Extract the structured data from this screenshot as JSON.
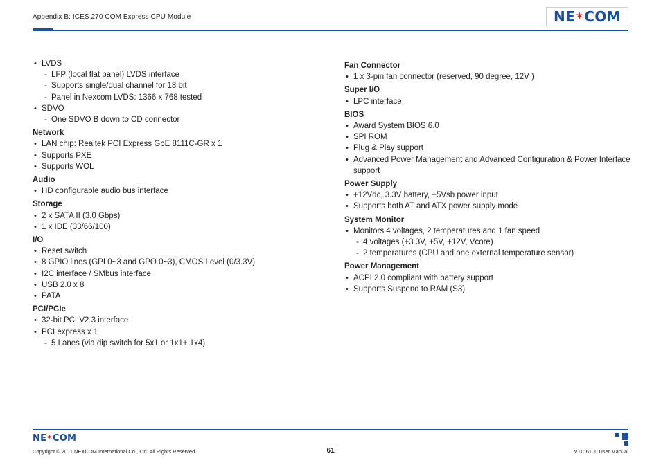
{
  "header": {
    "title": "Appendix B: ICES 270 COM Express CPU Module",
    "logo": {
      "pre": "NE",
      "star": "✶",
      "post": "COM"
    }
  },
  "left_column": [
    {
      "type": "bullets",
      "items": [
        {
          "text": "LVDS",
          "sub": [
            "LFP (local flat panel) LVDS interface",
            "Supports single/dual channel for 18 bit",
            "Panel in Nexcom LVDS: 1366 x 768 tested"
          ]
        },
        {
          "text": "SDVO",
          "sub": [
            "One SDVO B down to CD connector"
          ]
        }
      ]
    },
    {
      "type": "section",
      "heading": "Network",
      "items": [
        {
          "text": "LAN chip: Realtek PCI Express GbE 8111C-GR x 1"
        },
        {
          "text": "Supports PXE"
        },
        {
          "text": "Supports WOL"
        }
      ]
    },
    {
      "type": "section",
      "heading": "Audio",
      "items": [
        {
          "text": "HD configurable audio bus interface"
        }
      ]
    },
    {
      "type": "section",
      "heading": "Storage",
      "items": [
        {
          "text": "2 x SATA II (3.0 Gbps)"
        },
        {
          "text": "1 x IDE (33/66/100)"
        }
      ]
    },
    {
      "type": "section",
      "heading": "I/O",
      "items": [
        {
          "text": "Reset switch"
        },
        {
          "text": "8 GPIO lines (GPI 0~3 and GPO 0~3), CMOS Level (0/3.3V)"
        },
        {
          "text": "I2C interface / SMbus interface"
        },
        {
          "text": "USB 2.0 x 8"
        },
        {
          "text": "PATA"
        }
      ]
    },
    {
      "type": "section",
      "heading": "PCI/PCIe",
      "items": [
        {
          "text": "32-bit PCI V2.3 interface"
        },
        {
          "text": "PCI express x 1",
          "sub": [
            "5 Lanes (via dip switch for 5x1 or 1x1+ 1x4)"
          ]
        }
      ]
    }
  ],
  "right_column": [
    {
      "type": "section",
      "heading": "Fan Connector",
      "items": [
        {
          "text": "1 x 3-pin fan connector (reserved, 90 degree, 12V )"
        }
      ]
    },
    {
      "type": "section",
      "heading": "Super I/O",
      "items": [
        {
          "text": "LPC interface"
        }
      ]
    },
    {
      "type": "section",
      "heading": "BIOS",
      "items": [
        {
          "text": "Award System BIOS 6.0"
        },
        {
          "text": "SPI ROM"
        },
        {
          "text": "Plug & Play support"
        },
        {
          "text": "Advanced Power Management and Advanced Configuration & Power Interface support"
        }
      ]
    },
    {
      "type": "section",
      "heading": "Power Supply",
      "items": [
        {
          "text": "+12Vdc, 3.3V battery, +5Vsb power input"
        },
        {
          "text": "Supports both AT and ATX power supply mode"
        }
      ]
    },
    {
      "type": "section",
      "heading": "System Monitor",
      "items": [
        {
          "text": "Monitors 4 voltages, 2 temperatures and 1 fan speed",
          "sub": [
            "4 voltages (+3.3V, +5V, +12V, Vcore)",
            "2 temperatures (CPU and one external temperature sensor)"
          ]
        }
      ]
    },
    {
      "type": "section",
      "heading": "Power Management",
      "items": [
        {
          "text": "ACPI 2.0 compliant with battery support"
        },
        {
          "text": "Supports Suspend to RAM (S3)"
        }
      ]
    }
  ],
  "footer": {
    "logo": {
      "pre": "NE",
      "star": "✶",
      "post": "COM"
    },
    "copyright": "Copyright © 2011 NEXCOM International Co., Ltd. All Rights Reserved.",
    "page_number": "61",
    "manual": "VTC 6100 User Manual"
  },
  "colors": {
    "brand_blue": "#1f4e9d",
    "brand_red": "#cf2027",
    "text": "#231f20"
  }
}
